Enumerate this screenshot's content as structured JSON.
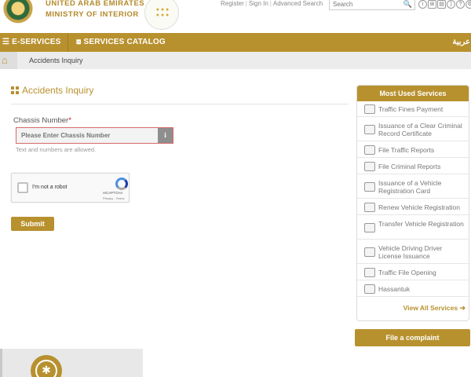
{
  "brand": {
    "line1": "UNITED ARAB EMIRATES",
    "line2": "MINISTRY OF INTERIOR"
  },
  "top_links": {
    "register": "Register",
    "sign_in": "Sign In",
    "advanced_search": "Advanced Search",
    "separator": "|"
  },
  "search": {
    "placeholder": "Search"
  },
  "navbar": {
    "eservices": "E-SERVICES",
    "catalog": "SERVICES CATALOG",
    "language": "عربية"
  },
  "breadcrumb": {
    "current": "Accidents Inquiry"
  },
  "page": {
    "title": "Accidents Inquiry",
    "chassis_label": "Chassis Number",
    "required_mark": "*",
    "chassis_placeholder": "Please Enter Chassis Number",
    "chassis_value": "",
    "info_button": "i",
    "hint": "Text and numbers are allowed.",
    "submit": "Submit"
  },
  "captcha": {
    "label": "I'm not a robot",
    "brand": "reCAPTCHA",
    "terms": "Privacy - Terms"
  },
  "sidebar": {
    "title": "Most Used Services",
    "items": [
      {
        "label": "Traffic Fines Payment",
        "icon": "car-fine-icon"
      },
      {
        "label": "Issuance of a Clear Criminal Record Certificate",
        "icon": "certificate-icon"
      },
      {
        "label": "File Traffic Reports",
        "icon": "car-report-icon"
      },
      {
        "label": "File Criminal Reports",
        "icon": "criminal-report-icon"
      },
      {
        "label": "Issuance of a Vehicle Registration Card",
        "icon": "registration-card-icon"
      },
      {
        "label": "Renew Vehicle Registration",
        "icon": "renew-vehicle-icon"
      },
      {
        "label": "Transfer Vehicle Registration",
        "icon": "transfer-vehicle-icon"
      },
      {
        "label": "Vehicle Driving Driver License Issuance",
        "icon": "driver-license-icon"
      },
      {
        "label": "Traffic File Opening",
        "icon": "traffic-file-icon"
      },
      {
        "label": "Hassantuk",
        "icon": "hassantuk-icon"
      }
    ],
    "view_all": "View All Services"
  },
  "complaint": {
    "label": "File a complaint"
  },
  "colors": {
    "accent": "#b8912f",
    "error_border": "#d76b6b",
    "required": "#d0021b"
  }
}
